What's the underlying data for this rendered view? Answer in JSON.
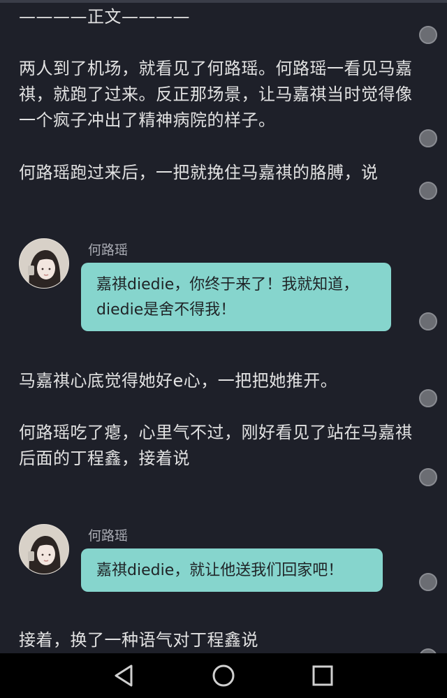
{
  "header": {
    "section_label": "————正文————"
  },
  "story": {
    "paragraph1": "两人到了机场，就看见了何路瑶。何路瑶一看见马嘉祺，就跑了过来。反正那场景，让马嘉祺当时觉得像一个疯子冲出了精神病院的样子。",
    "paragraph2": "何路瑶跑过来后，一把就挽住马嘉祺的胳膊，说",
    "paragraph3": "马嘉祺心底觉得她好e心，一把把她推开。",
    "paragraph4": "何路瑶吃了瘪，心里气不过，刚好看见了站在马嘉祺后面的丁程鑫，接着说",
    "paragraph5": "接着，换了一种语气对丁程鑫说"
  },
  "messages": [
    {
      "sender": "何路瑶",
      "text": "嘉祺diedie，你终于来了！我就知道，diedie是舍不得我！",
      "avatar": "girl-avatar"
    },
    {
      "sender": "何路瑶",
      "text": "嘉祺diedie，就让他送我们回家吧！",
      "avatar": "girl-avatar"
    }
  ],
  "navigation": {
    "icons": [
      "back-icon",
      "home-icon",
      "recents-icon"
    ]
  },
  "colors": {
    "background": "#1e2029",
    "bubble": "#86d5cd",
    "text": "#e2e2e2",
    "sender_name": "#a9abb3"
  }
}
